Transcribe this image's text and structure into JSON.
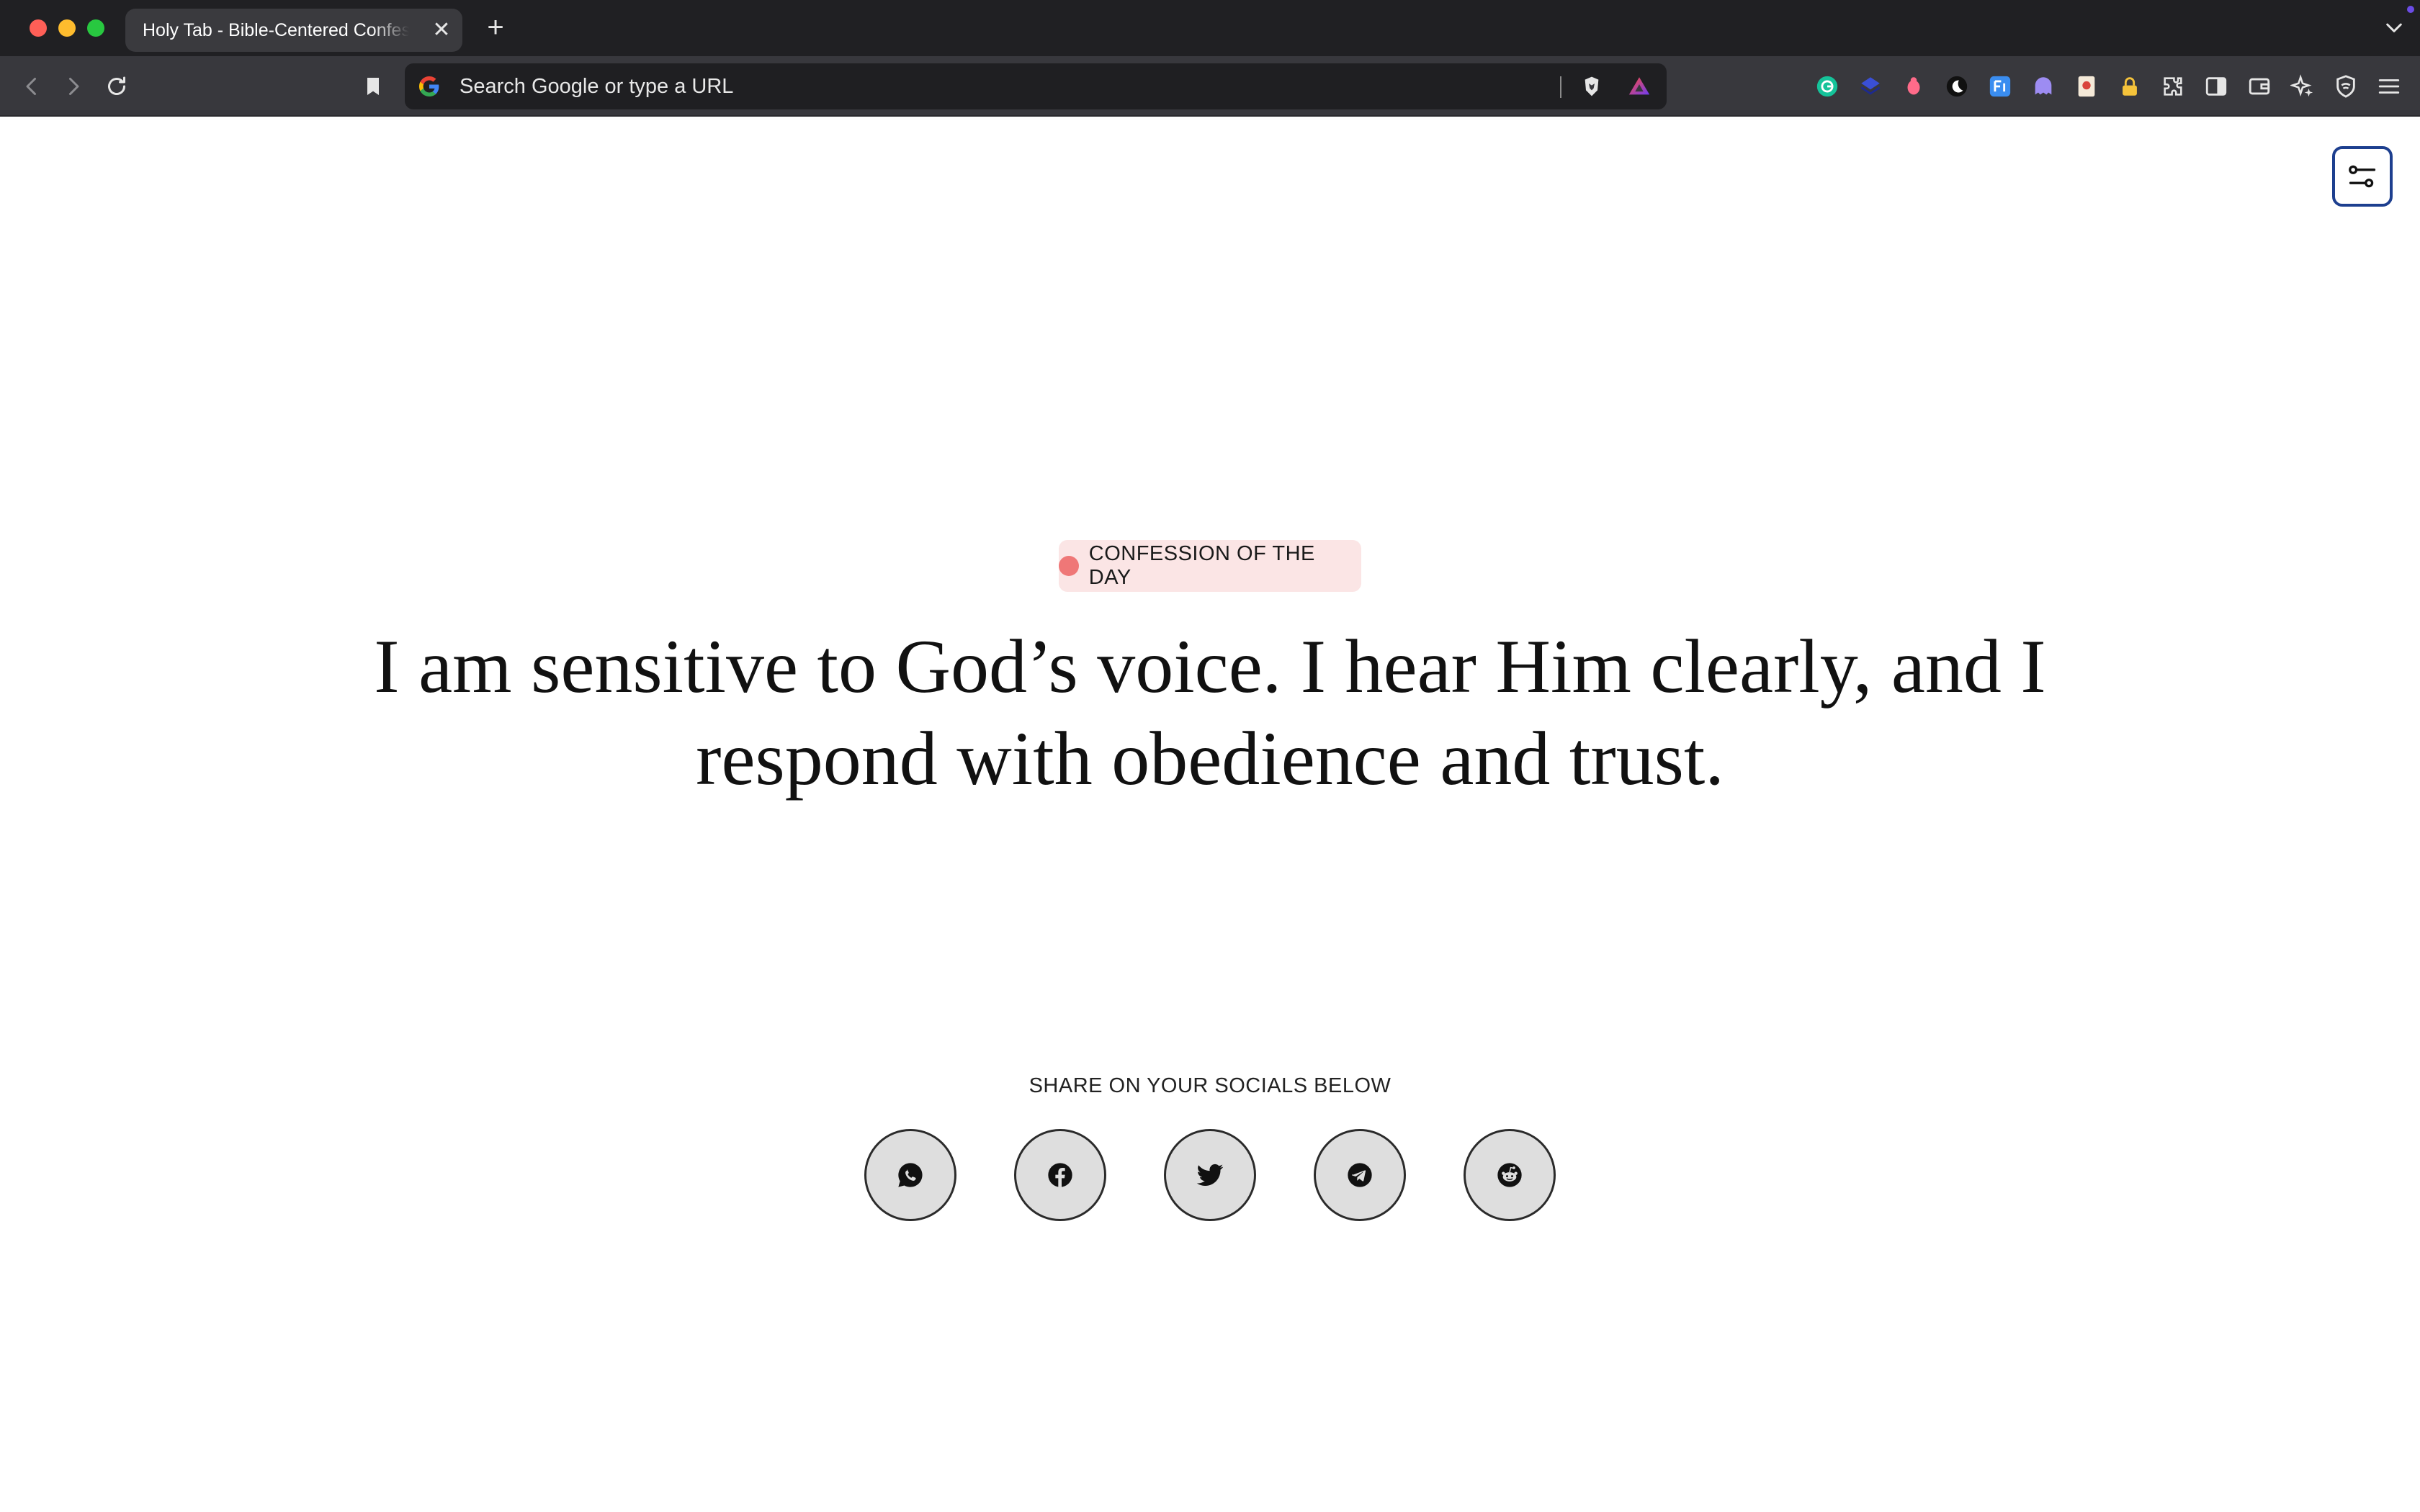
{
  "browser": {
    "tab_title": "Holy Tab - Bible-Centered Confessions",
    "tab_close_glyph": "✕",
    "new_tab_glyph": "+",
    "address_placeholder": "Search Google or type a URL"
  },
  "page": {
    "badge_label": "CONFESSION OF THE DAY",
    "confession_text": "I am sensitive to God’s voice. I hear Him clearly, and I respond with obedience and trust.",
    "share_label": "SHARE ON YOUR SOCIALS BELOW",
    "socials": [
      "whatsapp-icon",
      "facebook-icon",
      "twitter-icon",
      "telegram-icon",
      "reddit-icon"
    ]
  },
  "colors": {
    "badge_background": "#fbe5e5",
    "badge_dot": "#ef7777",
    "settings_border": "#1d3f8f",
    "social_background": "#dedede"
  }
}
